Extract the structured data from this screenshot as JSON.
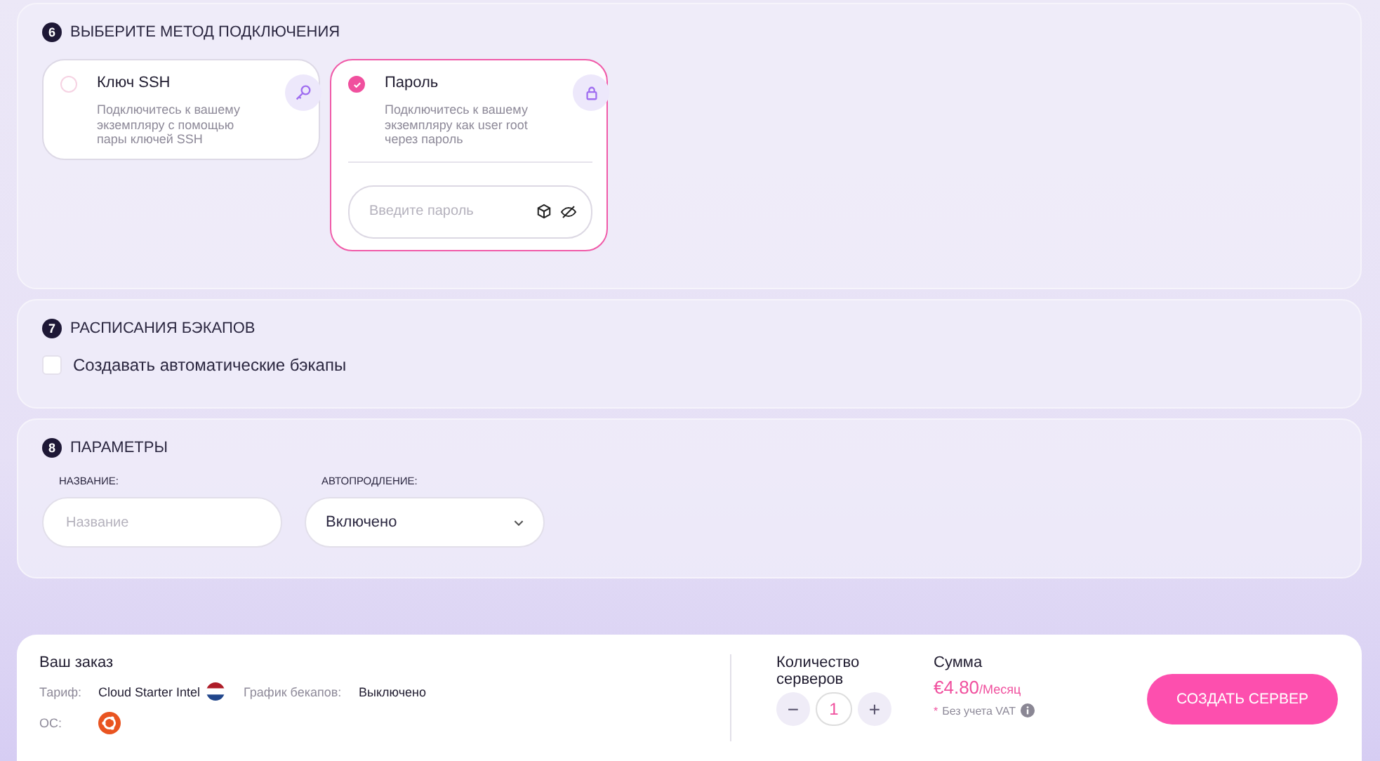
{
  "connection": {
    "number": "6",
    "title": "ВЫБЕРИТЕ МЕТОД ПОДКЛЮЧЕНИЯ",
    "methods": [
      {
        "kind": "key",
        "title": "Ключ SSH",
        "description": "Подключитесь к вашему экземпляру с помощью пары ключей SSH",
        "selected": false
      },
      {
        "kind": "password",
        "title": "Пароль",
        "description": "Подключитесь к вашему экземпляру как user root через пароль",
        "selected": true
      }
    ],
    "password_placeholder": "Введите пароль"
  },
  "backups": {
    "number": "7",
    "title": "РАСПИСАНИЯ БЭКАПОВ",
    "option": {
      "label": "Создавать автоматические бэкапы",
      "checked": false
    }
  },
  "parameters": {
    "number": "8",
    "title": "ПАРАМЕТРЫ",
    "name_field": {
      "label": "НАЗВАНИЕ:",
      "placeholder": "Название"
    },
    "renewal_field": {
      "label": "АВТОПРОДЛЕНИЕ:",
      "value": "Включено"
    }
  },
  "order": {
    "title": "Ваш заказ",
    "tariff_label": "Тариф:",
    "tariff": "Cloud Starter Intel",
    "backup_label": "График бекапов:",
    "backup_value": "Выключено",
    "os_label": "ОС:",
    "quantity_label": "Количество серверов",
    "quantity": "1",
    "minus": "−",
    "plus": "+",
    "sum_label": "Сумма",
    "price": "€4.80",
    "period": "/Месяц",
    "asterisk": "*",
    "vat_note": "Без учета VAT",
    "button": "СОЗДАТЬ СЕРВЕР"
  }
}
